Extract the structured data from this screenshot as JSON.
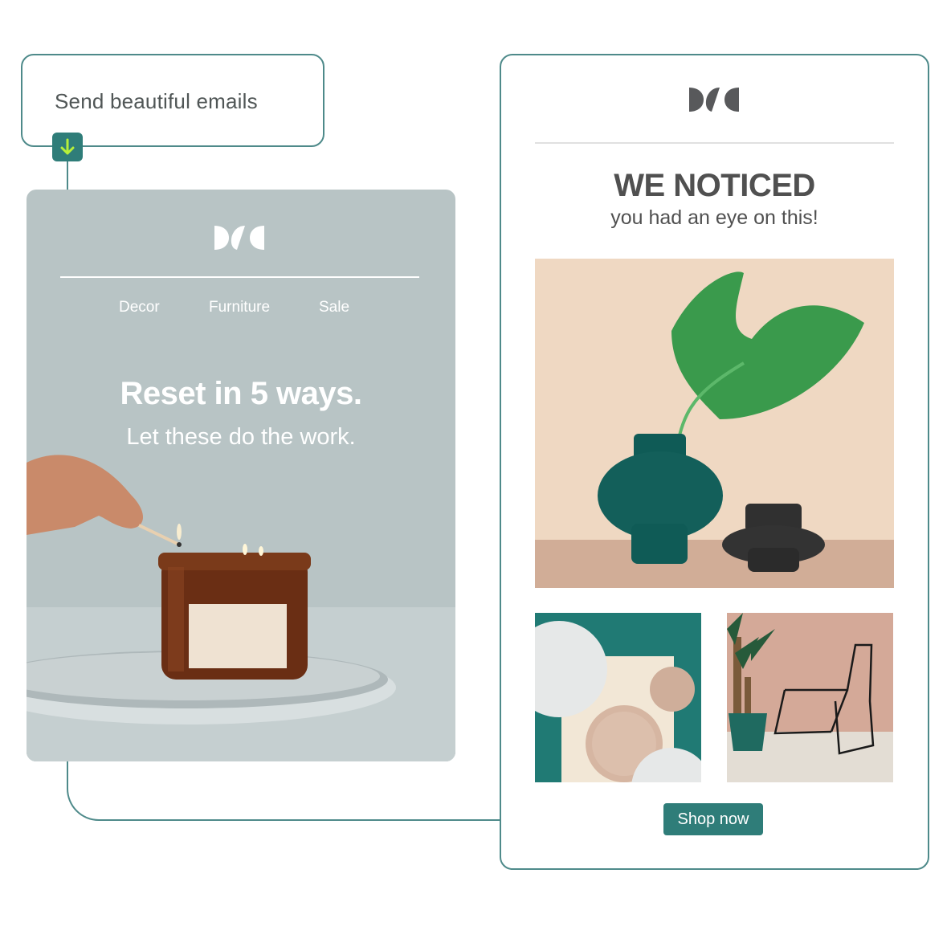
{
  "trigger": {
    "label": "Send beautiful emails",
    "icon": "arrow-down-icon"
  },
  "email_left": {
    "logo": "brand-logo",
    "nav": [
      "Decor",
      "Furniture",
      "Sale"
    ],
    "headline": "Reset in 5 ways.",
    "subheadline": "Let these do the work.",
    "image": "candle-being-lit-image"
  },
  "email_right": {
    "logo": "brand-logo",
    "title": "WE NOTICED",
    "subtitle": "you had an eye on this!",
    "hero_image": "teal-vase-with-leaf-image",
    "thumbnails": [
      "ceramic-bowls-image",
      "chair-and-plant-image"
    ],
    "cta_label": "Shop now"
  },
  "colors": {
    "accent": "#2f7d79",
    "border": "#4e8a8a",
    "arrow": "#b7f03a",
    "left_card_bg": "#b8c4c5",
    "text_dark": "#505050"
  }
}
